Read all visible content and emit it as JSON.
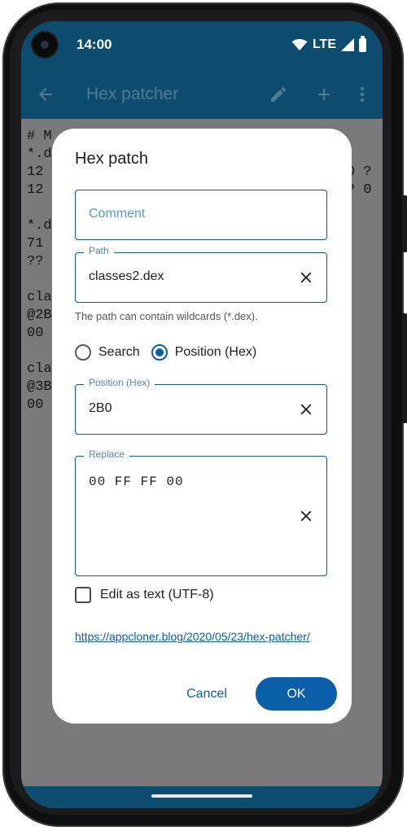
{
  "status_bar": {
    "time": "14:00",
    "network": "LTE"
  },
  "app_bar": {
    "title": "Hex patcher"
  },
  "background": {
    "lines": [
      "# M",
      "*.d",
      "12",
      "12",
      "",
      "*.d",
      "71",
      "??",
      "",
      "cla",
      "@2B",
      "00",
      "",
      "cla",
      "@3B",
      "00"
    ],
    "right_fragments": [
      "0 ?",
      "? 0"
    ]
  },
  "dialog": {
    "title": "Hex patch",
    "comment": {
      "placeholder": "Comment",
      "value": ""
    },
    "path": {
      "label": "Path",
      "value": "classes2.dex"
    },
    "path_helper": "The path can contain wildcards (*.dex).",
    "radio_options": [
      {
        "label": "Search",
        "checked": false
      },
      {
        "label": "Position (Hex)",
        "checked": true
      }
    ],
    "position": {
      "label": "Position (Hex)",
      "value": "2B0"
    },
    "replace": {
      "label": "Replace",
      "value": "00 FF FF 00"
    },
    "edit_as_text": {
      "label": "Edit as text (UTF-8)",
      "checked": false
    },
    "link": "https://appcloner.blog/2020/05/23/hex-patcher/",
    "cancel_label": "Cancel",
    "ok_label": "OK"
  },
  "colors": {
    "primary": "#0b5ea8",
    "app_bar": "#0d4c6f",
    "scrim_background": "#7a7a7a",
    "outline": "#0d5b93"
  },
  "icons": [
    "back-arrow-icon",
    "edit-pencil-icon",
    "add-icon",
    "more-vert-icon",
    "clear-icon",
    "wifi-icon",
    "signal-icon",
    "battery-icon"
  ]
}
